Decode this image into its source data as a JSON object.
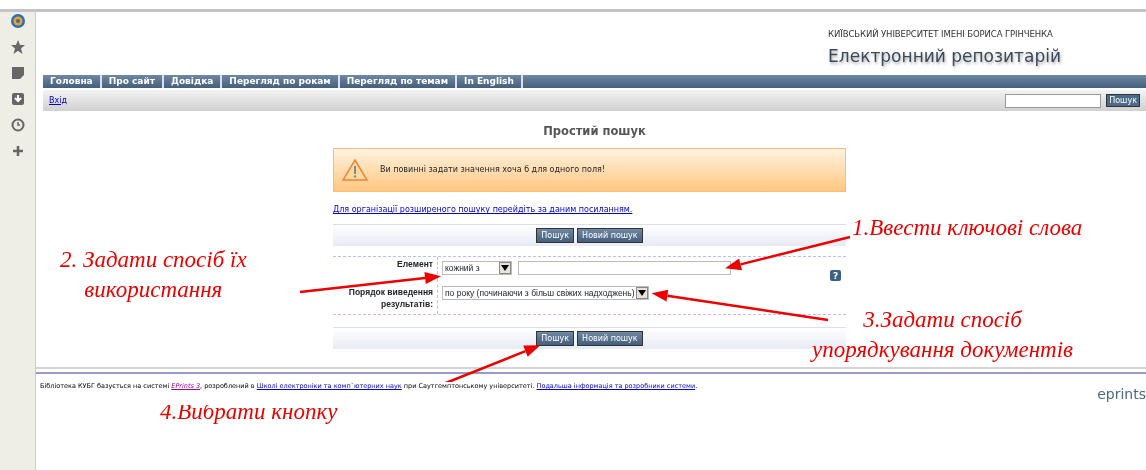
{
  "header": {
    "university": "КИЇВСЬКИЙ УНІВЕРСИТЕТ ІМЕНІ БОРИСА ГРІНЧЕНКА",
    "title": "Електронний репозитарій"
  },
  "nav": [
    {
      "label": "Головна"
    },
    {
      "label": "Про сайт"
    },
    {
      "label": "Довідка"
    },
    {
      "label": "Перегляд по рокам"
    },
    {
      "label": "Перегляд по темам"
    },
    {
      "label": "In English"
    }
  ],
  "login_link": "Вхід",
  "top_search": {
    "button": "Пошук"
  },
  "page_title": "Простий пошук",
  "warning": "Ви повинні задати значення хоча б для одного поля!",
  "advanced_link": "Для організації розширеного пошуку перейдіть за даним посиланням.",
  "buttons_top": [
    "Пошук",
    "Новий пошук"
  ],
  "form": {
    "element_label": "Елемент",
    "match_select": "кожний з",
    "order_label": "Порядок виведення результатів:",
    "order_select": "по року (починаючи з більш свіжих надходжень)",
    "help": "?"
  },
  "buttons_bottom": [
    "Пошук",
    "Новий пошук"
  ],
  "footer": {
    "before": "Бібліотека КУБГ базується на системі ",
    "eprints_link": "EPrints 3",
    "middle": ", розроблений в ",
    "school_link": "Школі електроніки та комп`ютерних наук",
    "after": " при Саутгемптонському університеті. ",
    "info_link": "Подальша інформація та розробники системи",
    "end": ".",
    "logo": "eprints"
  },
  "annotations": [
    {
      "lines": [
        "1.Ввести ключові слова"
      ]
    },
    {
      "lines": [
        "2. Задати спосіб їх",
        "використання"
      ]
    },
    {
      "lines": [
        "3.Задати спосіб",
        "упорядкування документів"
      ]
    },
    {
      "lines": [
        "4.Вибрати кнопку"
      ]
    }
  ]
}
